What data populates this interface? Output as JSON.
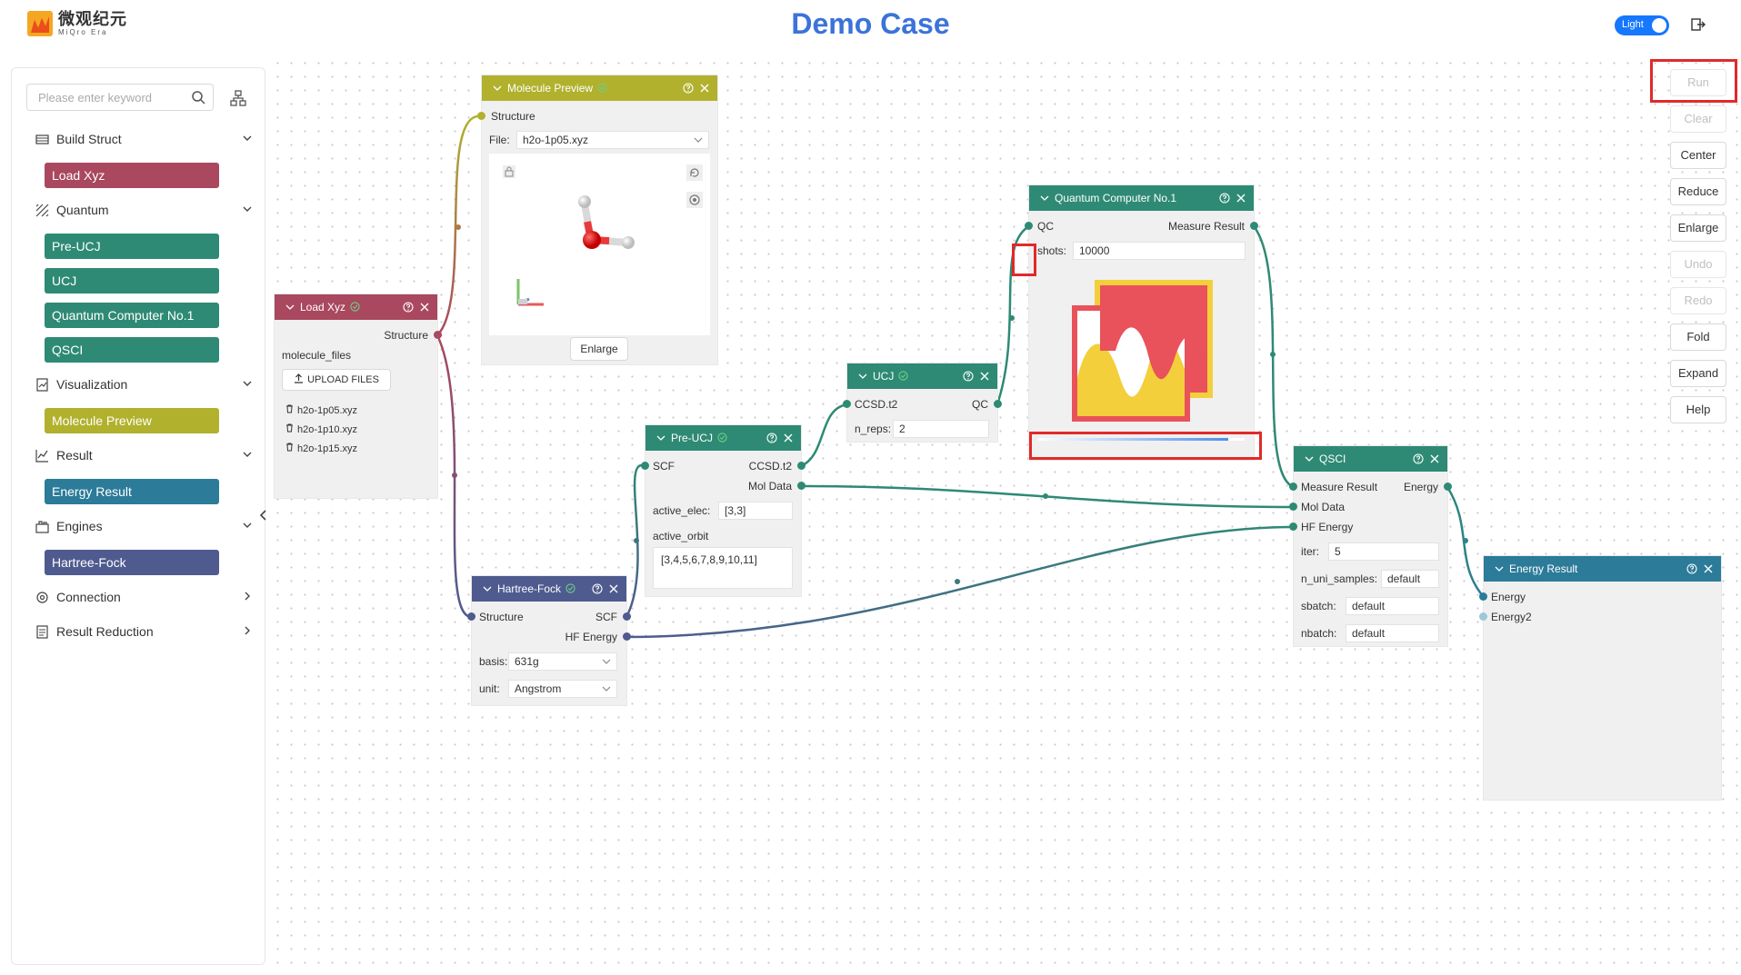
{
  "header": {
    "logo_cn": "微观纪元",
    "logo_en": "MiQro Era",
    "title": "Demo Case",
    "theme_label": "Light"
  },
  "sidebar": {
    "search_placeholder": "Please enter keyword",
    "categories": [
      {
        "label": "Build Struct",
        "items": [
          {
            "label": "Load Xyz",
            "color": "#a9485f"
          }
        ]
      },
      {
        "label": "Quantum",
        "items": [
          {
            "label": "Pre-UCJ",
            "color": "#2e8a74"
          },
          {
            "label": "UCJ",
            "color": "#2e8a74"
          },
          {
            "label": "Quantum Computer No.1",
            "color": "#2e8a74"
          },
          {
            "label": "QSCI",
            "color": "#2e8a74"
          }
        ]
      },
      {
        "label": "Visualization",
        "items": [
          {
            "label": "Molecule Preview",
            "color": "#b1b12e"
          }
        ]
      },
      {
        "label": "Result",
        "items": [
          {
            "label": "Energy Result",
            "color": "#2b7b99"
          }
        ]
      },
      {
        "label": "Engines",
        "items": [
          {
            "label": "Hartree-Fock",
            "color": "#4f5b8f"
          }
        ]
      },
      {
        "label": "Connection",
        "items": []
      },
      {
        "label": "Result Reduction",
        "items": []
      }
    ]
  },
  "nodes": {
    "load_xyz": {
      "title": "Load Xyz",
      "out_structure": "Structure",
      "files_label": "molecule_files",
      "upload": "UPLOAD FILES",
      "files": [
        "h2o-1p05.xyz",
        "h2o-1p10.xyz",
        "h2o-1p15.xyz"
      ],
      "color": "#a9485f"
    },
    "molecule_preview": {
      "title": "Molecule Preview",
      "in_structure": "Structure",
      "file_label": "File:",
      "file_value": "h2o-1p05.xyz",
      "enlarge": "Enlarge",
      "color": "#b1b12e"
    },
    "hartree_fock": {
      "title": "Hartree-Fock",
      "in_structure": "Structure",
      "out_scf": "SCF",
      "out_hf": "HF Energy",
      "basis_label": "basis:",
      "basis_value": "631g",
      "unit_label": "unit:",
      "unit_value": "Angstrom",
      "color": "#4f5b8f"
    },
    "pre_ucj": {
      "title": "Pre-UCJ",
      "in_scf": "SCF",
      "out_ccsd": "CCSD.t2",
      "out_mol": "Mol Data",
      "active_elec_label": "active_elec:",
      "active_elec_value": "[3,3]",
      "active_orbit_label": "active_orbit",
      "active_orbit_value": "[3,4,5,6,7,8,9,10,11]",
      "color": "#2e8a74"
    },
    "ucj": {
      "title": "UCJ",
      "in_ccsd": "CCSD.t2",
      "out_qc": "QC",
      "n_reps_label": "n_reps:",
      "n_reps_value": "2",
      "color": "#2e8a74"
    },
    "quantum_computer": {
      "title": "Quantum Computer No.1",
      "in_qc": "QC",
      "out_measure": "Measure Result",
      "shots_label": "shots:",
      "shots_value": "10000",
      "color": "#2e8a74",
      "progress": 0.92
    },
    "qsci": {
      "title": "QSCI",
      "in_measure": "Measure Result",
      "in_mol": "Mol Data",
      "in_hf": "HF Energy",
      "out_energy": "Energy",
      "iter_label": "iter:",
      "iter_value": "5",
      "n_uni_label": "n_uni_samples:",
      "n_uni_value": "default",
      "sbatch_label": "sbatch:",
      "sbatch_value": "default",
      "nbatch_label": "nbatch:",
      "nbatch_value": "default",
      "color": "#2e8a74"
    },
    "energy_result": {
      "title": "Energy Result",
      "in_energy": "Energy",
      "in_energy2": "Energy2",
      "color": "#2b7b99"
    }
  },
  "toolbar": {
    "run": "Run",
    "clear": "Clear",
    "center": "Center",
    "reduce": "Reduce",
    "enlarge": "Enlarge",
    "undo": "Undo",
    "redo": "Redo",
    "fold": "Fold",
    "expand": "Expand",
    "help": "Help"
  },
  "colors": {
    "accent": "#3b73d9",
    "highlight": "#e02a2a",
    "wire": "#2e8a74"
  }
}
